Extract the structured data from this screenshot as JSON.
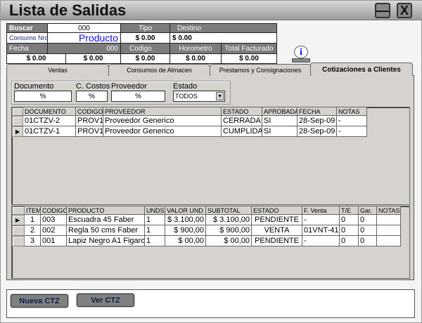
{
  "window": {
    "title": "Lista de Salidas",
    "minimize_icon": "minimize-icon",
    "close_icon": "close-icon"
  },
  "header": {
    "buscar_label": "Buscar",
    "buscar_value": "000",
    "tipo_label": "Tipo",
    "destino_label": "Destino",
    "consumo_label": "Consumo Nro:",
    "consumo_value": "Producto",
    "tipo_value": "$ 0.00",
    "destino_value": "$ 0.00",
    "fecha_label": "Fecha",
    "fecha_code": "000",
    "codigo_label": "Codigo",
    "horometro_label": "Horometro",
    "total_label": "Total Facturado",
    "row4": [
      "$ 0.00",
      "$ 0.00",
      "$ 0.00",
      "$ 0.00",
      "$ 0.00"
    ]
  },
  "info_icon": "info-icon",
  "tabs": [
    {
      "label": "Ventas"
    },
    {
      "label": "Consumos de Almacen"
    },
    {
      "label": "Prestamos y Consignaciones"
    },
    {
      "label": "Cotizaciones a Clientes",
      "active": true
    }
  ],
  "filters": {
    "documento_label": "Documento",
    "documento_value": "%",
    "ccostos_label": "C. Costos",
    "ccostos_value": "%",
    "proveedor_label": "Proveedor",
    "proveedor_value": "%",
    "estado_label": "Estado",
    "estado_value": "TODOS"
  },
  "quotes": {
    "columns": [
      "DOCUMENTO",
      "CODIGO",
      "PROVEEDOR",
      "ESTADO",
      "APROBADA",
      "FECHA",
      "NOTAS"
    ],
    "rows": [
      [
        "01CTZV-2",
        "PROV1",
        "Proveedor Generico",
        "CERRADA",
        "SI",
        "28-Sep-09",
        "-"
      ],
      [
        "01CTZV-1",
        "PROV1",
        "Proveedor Generico",
        "CUMPLIDA",
        "SI",
        "28-Sep-09",
        "-"
      ]
    ],
    "selected_row": 1
  },
  "items": {
    "columns": [
      "ITEM",
      "CODIGO",
      "PRODUCTO",
      "UNDS",
      "VALOR UND",
      "SUBTOTAL",
      "ESTADO",
      "F. Venta",
      "T/E",
      "Gar.",
      "NOTAS"
    ],
    "rows": [
      [
        "1",
        "003",
        "Escuadra 45 Faber",
        "1",
        "$ 3.100,00",
        "$ 3.100,00",
        "PENDIENTE",
        "-",
        "0",
        "0",
        ""
      ],
      [
        "2",
        "002",
        "Regla 50 cms Faber",
        "1",
        "$ 900,00",
        "$ 900,00",
        "VENTA",
        "01VNT-41",
        "0",
        "0",
        ""
      ],
      [
        "3",
        "001",
        "Lapiz Negro A1 Figaro",
        "1",
        "$ 00,00",
        "$ 00,00",
        "PENDIENTE",
        "-",
        "0",
        "0",
        ""
      ]
    ],
    "selected_row": 0
  },
  "buttons": {
    "nueva": "Nueva CTZ",
    "ver": "Ver CTZ"
  }
}
